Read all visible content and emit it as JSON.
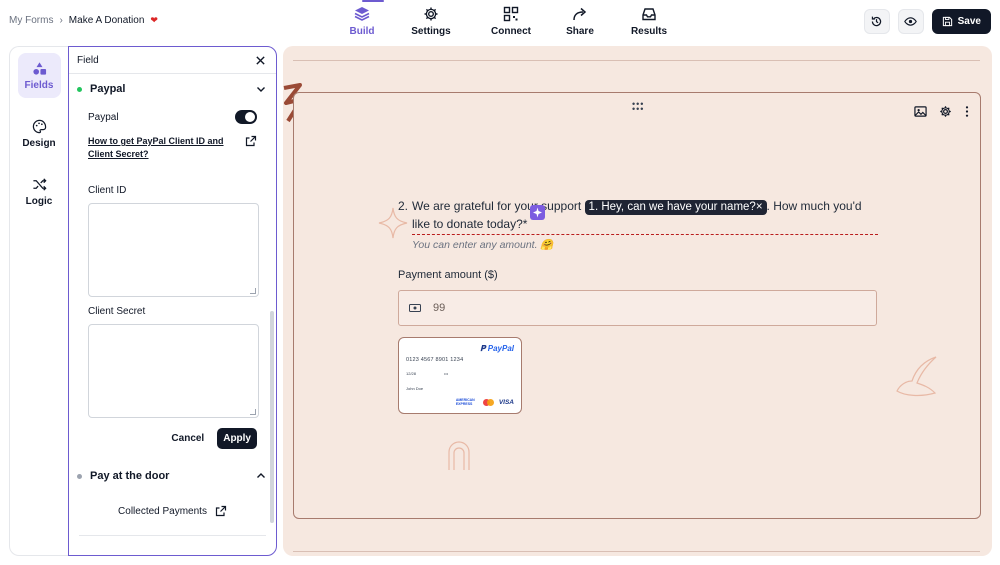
{
  "breadcrumb": {
    "root": "My Forms",
    "separator": "›",
    "current": "Make A Donation"
  },
  "nav": [
    {
      "label": "Build",
      "icon": "layers-icon",
      "active": true
    },
    {
      "label": "Settings",
      "icon": "gear-icon",
      "active": false
    },
    {
      "label": "Connect",
      "icon": "qr-icon",
      "active": false
    },
    {
      "label": "Share",
      "icon": "share-arrow-icon",
      "active": false
    },
    {
      "label": "Results",
      "icon": "inbox-icon",
      "active": false
    }
  ],
  "toolbar": {
    "save_label": "Save"
  },
  "rail": [
    {
      "label": "Fields",
      "icon": "shapes-icon",
      "active": true
    },
    {
      "label": "Design",
      "icon": "palette-icon",
      "active": false
    },
    {
      "label": "Logic",
      "icon": "shuffle-icon",
      "active": false
    }
  ],
  "panel": {
    "title": "Field",
    "paypal": {
      "heading": "Paypal",
      "status_color": "#22c55e",
      "toggle_label": "Paypal",
      "toggle_on": true,
      "help_link": "How to get PayPal Client ID and Client Secret?",
      "client_id_label": "Client ID",
      "client_id_value": "",
      "client_secret_label": "Client Secret",
      "client_secret_value": "",
      "cancel_label": "Cancel",
      "apply_label": "Apply"
    },
    "door": {
      "heading": "Pay at the door",
      "status_color": "#9ca3af"
    },
    "collected_payments_label": "Collected Payments"
  },
  "question": {
    "number": "2.",
    "text_before": "We are grateful for your support",
    "pill": "1. Hey, can we have your name?",
    "pill_close": "×",
    "text_after": ". How much you'd like to donate today?*",
    "hint": "You can enter any amount. 🤗",
    "payment_label": "Payment amount ($)",
    "payment_value": "99"
  },
  "paypal_card": {
    "logo": "PayPal",
    "number": "0123 4567 8901 1234",
    "expiry": "12/28",
    "cvv": "•••",
    "name": "John Doe",
    "brands": [
      "AMERICAN EXPRESS",
      "VISA"
    ]
  },
  "colors": {
    "accent": "#6d5bd0",
    "canvas_bg": "#f6e8e0",
    "dark": "#111827"
  }
}
